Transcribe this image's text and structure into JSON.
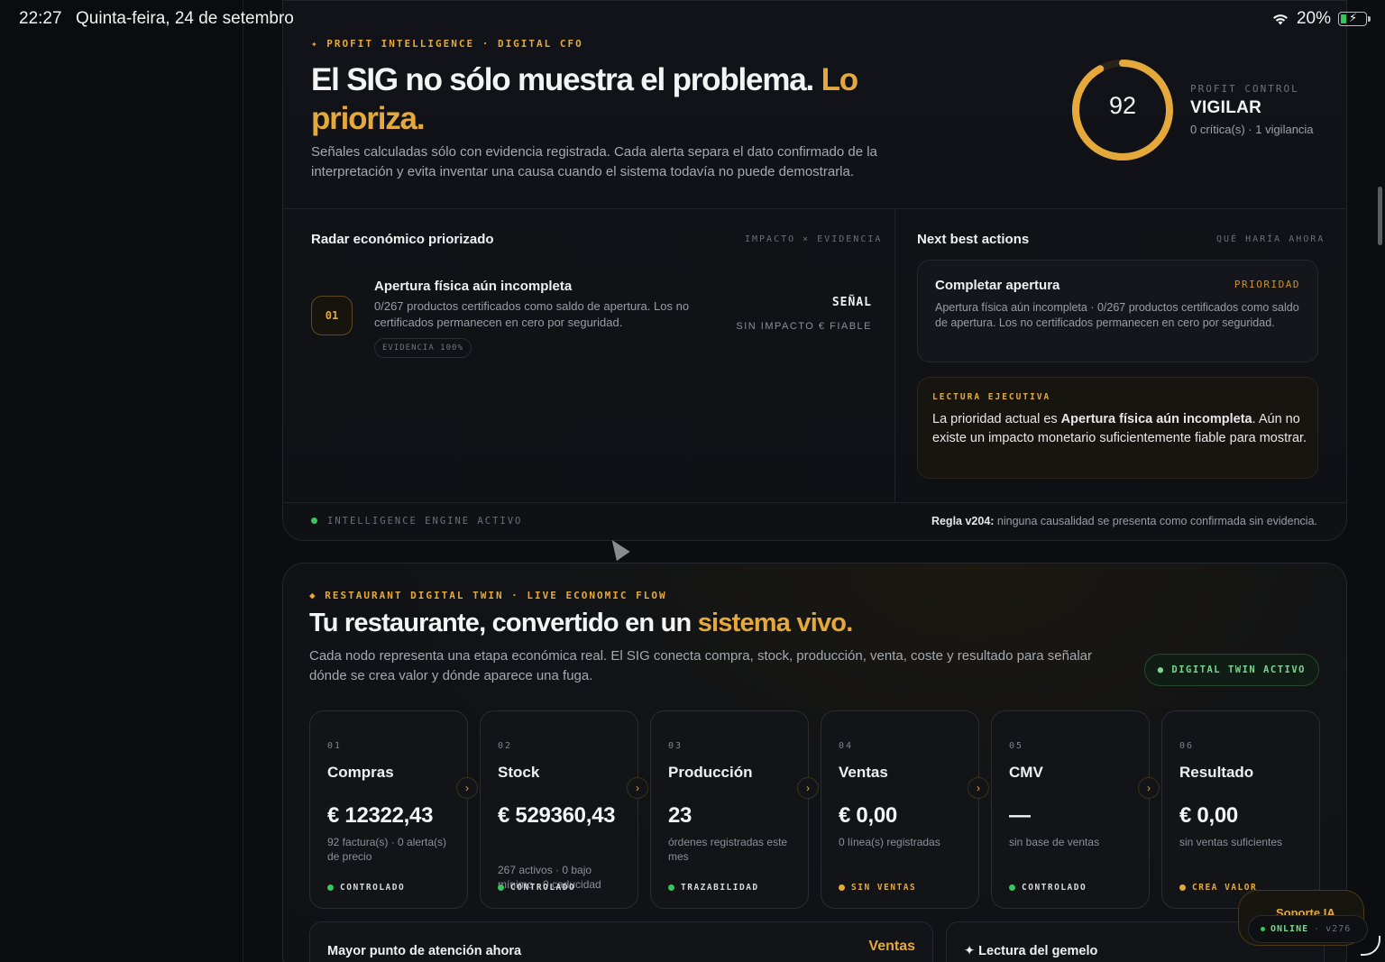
{
  "status_bar": {
    "time": "22:27",
    "date": "Quinta-feira, 24 de setembro",
    "battery": "20%"
  },
  "intel": {
    "kicker": "✦ PROFIT INTELLIGENCE · DIGITAL CFO",
    "headline_white": "El SIG no sólo muestra el problema.",
    "headline_gold": "Lo prioriza.",
    "lead": "Señales calculadas sólo con evidencia registrada. Cada alerta separa el dato confirmado de la interpretación y evita inventar una causa cuando el sistema todavía no puede demostrarla.",
    "score": "92",
    "score_fraction": 0.92,
    "control_label": "PROFIT CONTROL",
    "control_status": "VIGILAR",
    "control_sub": "0 crítica(s) · 1 vigilancia",
    "radar_title": "Radar económico priorizado",
    "radar_meta": "IMPACTO × EVIDENCIA",
    "radar_item": {
      "num": "01",
      "title": "Apertura física aún incompleta",
      "desc": "0/267 productos certificados como saldo de apertura. Los no certificados permanecen en cero por seguridad.",
      "evidence": "EVIDENCIA 100%",
      "signal": "SEÑAL",
      "impact": "SIN IMPACTO € FIABLE"
    },
    "nba_title": "Next best actions",
    "nba_meta": "QUÉ HARÍA AHORA",
    "nba_item": {
      "title": "Completar apertura",
      "priority": "PRIORIDAD",
      "desc": "Apertura física aún incompleta · 0/267 productos certificados como saldo de apertura. Los no certificados permanecen en cero por seguridad."
    },
    "exec": {
      "kicker": "LECTURA EJECUTIVA",
      "text_pre": "La prioridad actual es ",
      "text_bold": "Apertura física aún incompleta",
      "text_post": ". Aún no existe un impacto monetario suficientemente fiable para mostrar."
    },
    "footer_left": "INTELLIGENCE ENGINE ACTIVO",
    "footer_rule_bold": "Regla v204:",
    "footer_rule_text": " ninguna causalidad se presenta como confirmada sin evidencia."
  },
  "twin": {
    "kicker": "◆ RESTAURANT DIGITAL TWIN · LIVE ECONOMIC FLOW",
    "headline_white": "Tu restaurante, convertido en un ",
    "headline_gold": "sistema vivo.",
    "lead": "Cada nodo representa una etapa económica real. El SIG conecta compra, stock, producción, venta, coste y resultado para señalar dónde se crea valor y dónde aparece una fuga.",
    "badge": "● DIGITAL TWIN ACTIVO",
    "nodes": [
      {
        "num": "01",
        "title": "Compras",
        "value": "€ 12322,43",
        "sub": "92 factura(s) · 0 alerta(s) de precio",
        "status": "CONTROLADO"
      },
      {
        "num": "02",
        "title": "Stock",
        "value": "€ 529360,43",
        "sub": "267 activos · 0 bajo mínimo · 0 caducidad",
        "status": "CONTROLADO"
      },
      {
        "num": "03",
        "title": "Producción",
        "value": "23",
        "sub": "órdenes registradas este mes",
        "status": "TRAZABILIDAD"
      },
      {
        "num": "04",
        "title": "Ventas",
        "value": "€ 0,00",
        "sub": "0 línea(s) registradas",
        "status": "SIN VENTAS"
      },
      {
        "num": "05",
        "title": "CMV",
        "value": "—",
        "sub": "sin base de ventas",
        "status": "CONTROLADO"
      },
      {
        "num": "06",
        "title": "Resultado",
        "value": "€ 0,00",
        "sub": "sin ventas suficientes",
        "status": "CREA VALOR"
      }
    ],
    "attention_title": "Mayor punto de atención ahora",
    "attention_value": "Ventas",
    "reading_title": "✦ Lectura del gemelo"
  },
  "support": {
    "label": "Soporte IA",
    "online": "ONLINE",
    "version": "v276"
  },
  "colors": {
    "accent": "#e5a93b",
    "ok": "#35c759",
    "bg": "#0c0d10"
  }
}
